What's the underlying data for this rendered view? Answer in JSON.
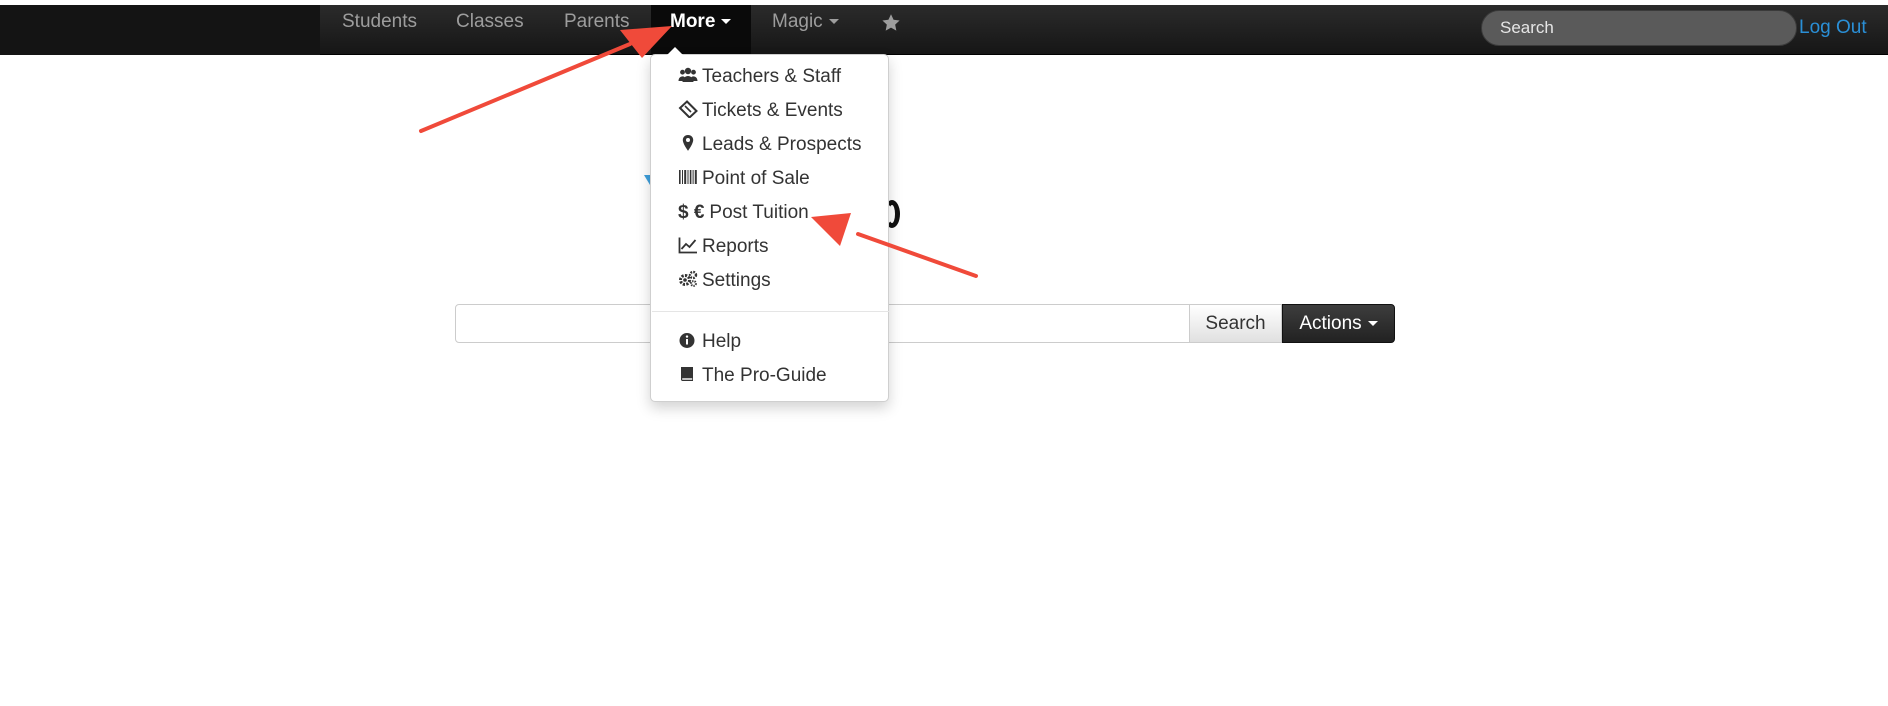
{
  "navbar": {
    "items": [
      {
        "label": "Students"
      },
      {
        "label": "Classes"
      },
      {
        "label": "Parents"
      },
      {
        "label": "More"
      },
      {
        "label": "Magic"
      }
    ],
    "favorites_icon": "star-icon",
    "search_placeholder": "Search",
    "logout_label": "Log Out"
  },
  "dropdown": {
    "items": [
      {
        "label": "Teachers & Staff",
        "icon": "users-icon"
      },
      {
        "label": "Tickets & Events",
        "icon": "ticket-icon"
      },
      {
        "label": "Leads & Prospects",
        "icon": "map-marker-icon"
      },
      {
        "label": "Point of Sale",
        "icon": "barcode-icon"
      },
      {
        "label": "Post Tuition",
        "icon": "currency-icon",
        "icon_text": "$ €"
      },
      {
        "label": "Reports",
        "icon": "line-chart-icon"
      },
      {
        "label": "Settings",
        "icon": "gears-icon"
      },
      {
        "label": "Help",
        "icon": "info-circle-icon"
      },
      {
        "label": "The Pro-Guide",
        "icon": "book-icon"
      }
    ]
  },
  "main": {
    "search_button": "Search",
    "actions_button": "Actions"
  },
  "colors": {
    "navbar_bg": "#1b1b1b",
    "link_blue": "#2a8fd6",
    "annotation_arrow": "#f04a3a"
  }
}
